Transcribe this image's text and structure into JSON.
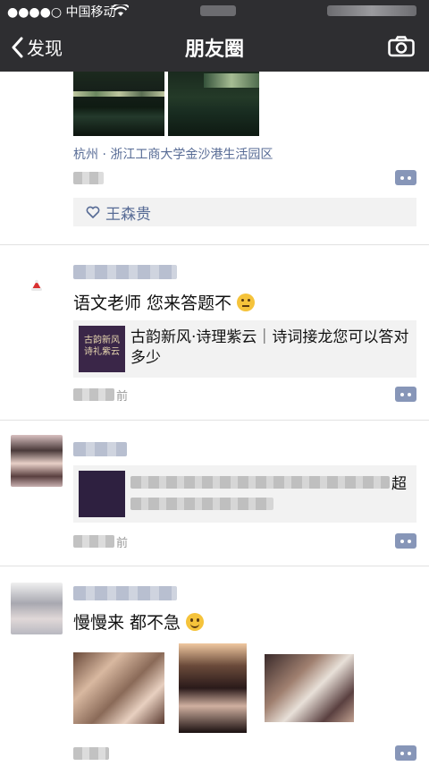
{
  "status_bar": {
    "carrier": "●●●●○ 中国移动"
  },
  "nav": {
    "back_label": "发现",
    "title": "朋友圈"
  },
  "posts": [
    {
      "location": "杭州 · 浙江工商大学金沙港生活园区",
      "likes": "王森贵"
    },
    {
      "text": "语文老师 您来答题不",
      "link_title": "古韵新风·诗理紫云｜诗词接龙您可以答对多少",
      "link_thumb_text": "古韵新风诗礼紫云",
      "time_suffix": "前"
    },
    {
      "link_title_suffix": "超",
      "time_suffix": "前"
    },
    {
      "text": "慢慢来 都不急"
    }
  ],
  "colors": {
    "link": "#576b95",
    "topbar": "#2e2e31",
    "card_bg": "#f2f2f2"
  }
}
